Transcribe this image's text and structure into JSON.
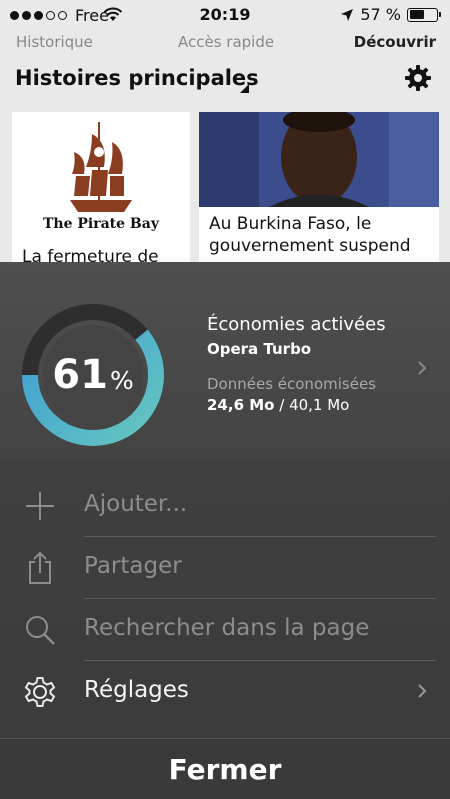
{
  "status_bar": {
    "carrier": "Free",
    "time": "20:19",
    "battery": "57 %",
    "battery_level": 0.57
  },
  "tabs": [
    {
      "label": "Historique"
    },
    {
      "label": "Accès rapide"
    },
    {
      "label": "Découvrir",
      "selected": true
    }
  ],
  "section": {
    "title": "Histoires principales"
  },
  "cards": [
    {
      "image_label": "The Pirate Bay",
      "text": "La fermeture de"
    },
    {
      "text": "Au Burkina Faso, le gouvernement suspend"
    }
  ],
  "turbo": {
    "percent": "61",
    "percent_sign": "%",
    "fraction": 0.61,
    "title": "Économies activées",
    "subtitle": "Opera Turbo",
    "data_label": "Données économisées",
    "saved": "24,6 Mo",
    "total": "/ 40,1 Mo",
    "colors": {
      "ring_start": "#66c6c0",
      "ring_end": "#3a9bd4",
      "track": "#2e2e2e"
    }
  },
  "menu": [
    {
      "label": "Ajouter...",
      "icon": "plus-icon"
    },
    {
      "label": "Partager",
      "icon": "share-icon"
    },
    {
      "label": "Rechercher dans la page",
      "icon": "search-icon"
    },
    {
      "label": "Réglages",
      "icon": "gear-icon"
    }
  ],
  "close": {
    "label": "Fermer"
  }
}
